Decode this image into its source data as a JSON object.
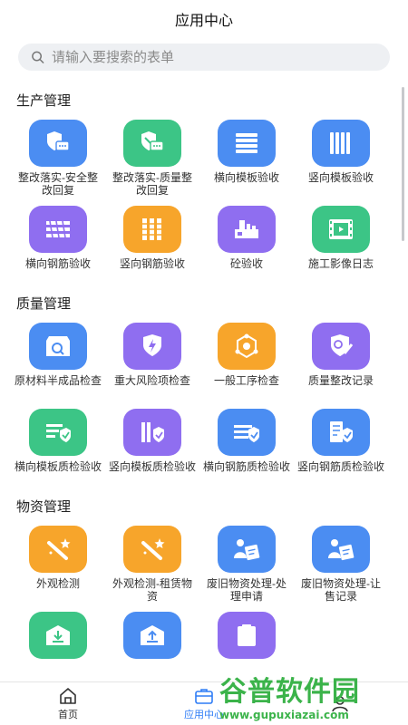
{
  "header": {
    "title": "应用中心"
  },
  "search": {
    "placeholder": "请输入要搜索的表单"
  },
  "sections": [
    {
      "title": "生产管理",
      "items": [
        {
          "label": "整改落实-安全整改回复",
          "color": "#4b8df2",
          "icon": "shield-chat-icon"
        },
        {
          "label": "整改落实-质量整改回复",
          "color": "#3cc586",
          "icon": "wrench-chat-icon"
        },
        {
          "label": "横向模板验收",
          "color": "#4b8df2",
          "icon": "horizontal-bars-icon"
        },
        {
          "label": "竖向模板验收",
          "color": "#4b8df2",
          "icon": "vertical-bars-icon"
        },
        {
          "label": "横向钢筋验收",
          "color": "#8f6ef0",
          "icon": "rebar-horizontal-icon"
        },
        {
          "label": "竖向钢筋验收",
          "color": "#f7a52b",
          "icon": "rebar-vertical-icon"
        },
        {
          "label": "砼验收",
          "color": "#8f6ef0",
          "icon": "concrete-truck-icon"
        },
        {
          "label": "施工影像日志",
          "color": "#3cc586",
          "icon": "film-icon"
        }
      ]
    },
    {
      "title": "质量管理",
      "items": [
        {
          "label": "原材料半成品检查",
          "color": "#4b8df2",
          "icon": "box-search-icon"
        },
        {
          "label": "重大风险项检查",
          "color": "#8f6ef0",
          "icon": "shield-bolt-icon"
        },
        {
          "label": "一般工序检查",
          "color": "#f7a52b",
          "icon": "hexagon-nodes-icon"
        },
        {
          "label": "质量整改记录",
          "color": "#8f6ef0",
          "icon": "shield-edit-icon"
        },
        {
          "label": "横向模板质检验收",
          "color": "#3cc586",
          "icon": "list-check-icon"
        },
        {
          "label": "竖向模板质检验收",
          "color": "#8f6ef0",
          "icon": "bars-check-icon"
        },
        {
          "label": "横向钢筋质检验收",
          "color": "#4b8df2",
          "icon": "rebar-check-icon"
        },
        {
          "label": "竖向钢筋质检验收",
          "color": "#4b8df2",
          "icon": "doc-check-icon"
        }
      ]
    },
    {
      "title": "物资管理",
      "items": [
        {
          "label": "外观检测",
          "color": "#f7a52b",
          "icon": "magic-wand-icon"
        },
        {
          "label": "外观检测-租赁物资",
          "color": "#f7a52b",
          "icon": "magic-wand-icon"
        },
        {
          "label": "废旧物资处理-处理申请",
          "color": "#4b8df2",
          "icon": "person-doc-icon"
        },
        {
          "label": "废旧物资处理-让售记录",
          "color": "#4b8df2",
          "icon": "person-doc-icon"
        },
        {
          "label": "",
          "color": "#3cc586",
          "icon": "warehouse-in-icon"
        },
        {
          "label": "",
          "color": "#4b8df2",
          "icon": "warehouse-out-icon"
        },
        {
          "label": "",
          "color": "#8f6ef0",
          "icon": "clipboard-icon"
        }
      ]
    }
  ],
  "tabbar": {
    "tabs": [
      {
        "label": "首页",
        "icon": "home-icon",
        "active": false
      },
      {
        "label": "应用中心",
        "icon": "briefcase-icon",
        "active": true
      },
      {
        "label": "",
        "icon": "user-icon",
        "active": false
      }
    ]
  },
  "watermark": {
    "text": "谷普软件园",
    "url": "www.gupuxiazai.com"
  }
}
